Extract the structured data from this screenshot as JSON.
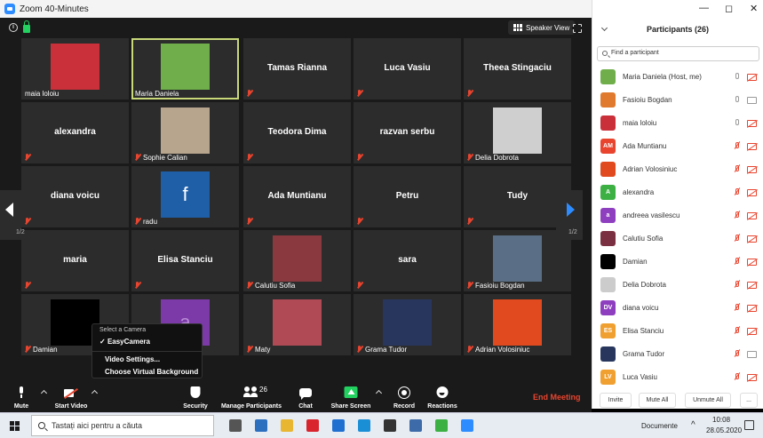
{
  "window": {
    "title": "Zoom 40-Minutes",
    "controls": [
      "—",
      "◻",
      "✕"
    ]
  },
  "meeting": {
    "speaker_view_label": "Speaker View",
    "page_indicator": "1/2",
    "tiles": [
      {
        "name": "maia loloiu",
        "type": "image",
        "color": "#c9303a"
      },
      {
        "name": "Maria Daniela",
        "type": "image",
        "active": true,
        "color": "#6fae4a"
      },
      {
        "name": "Tamas Rianna",
        "type": "name"
      },
      {
        "name": "Luca Vasiu",
        "type": "name"
      },
      {
        "name": "Theea Stingaciu",
        "type": "name"
      },
      {
        "name": "alexandra",
        "type": "name"
      },
      {
        "name": "Sophie Calian",
        "type": "image",
        "color": "#b8a58e"
      },
      {
        "name": "Teodora Dima",
        "type": "name"
      },
      {
        "name": "razvan serbu",
        "type": "name"
      },
      {
        "name": "Delia Dobrota",
        "type": "image",
        "color": "#cfcfcf"
      },
      {
        "name": "diana voicu",
        "type": "name"
      },
      {
        "name": "radu",
        "type": "facebook",
        "color": "#1e5fa8",
        "glyph": "f"
      },
      {
        "name": "Ada Muntianu",
        "type": "name"
      },
      {
        "name": "Petru",
        "type": "name"
      },
      {
        "name": "Tudy",
        "type": "name"
      },
      {
        "name": "maria",
        "type": "name"
      },
      {
        "name": "Elisa Stanciu",
        "type": "name"
      },
      {
        "name": "Calutiu Sofia",
        "type": "image",
        "color": "#8a3a3e"
      },
      {
        "name": "sara",
        "type": "name"
      },
      {
        "name": "Fasioiu Bogdan",
        "type": "image",
        "color": "#5a6f86"
      },
      {
        "name": "Damian",
        "type": "image",
        "color": "#000000"
      },
      {
        "name": "",
        "type": "image",
        "color": "#7b3aa8",
        "glyph": "a"
      },
      {
        "name": "Maty",
        "type": "image",
        "color": "#b04b56"
      },
      {
        "name": "Grama Tudor",
        "type": "image",
        "color": "#28365e"
      },
      {
        "name": "Adrian Volosiniuc",
        "type": "image",
        "color": "#e04a1e"
      }
    ]
  },
  "camera_menu": {
    "header": "Select a Camera",
    "selected": "EasyCamera",
    "options": [
      "Video Settings...",
      "Choose Virtual Background"
    ]
  },
  "toolbar": {
    "mute": "Mute",
    "start_video": "Start Video",
    "security": "Security",
    "manage_participants": "Manage Participants",
    "participant_count": "26",
    "chat": "Chat",
    "share_screen": "Share Screen",
    "record": "Record",
    "reactions": "Reactions",
    "end_meeting": "End Meeting"
  },
  "participants_panel": {
    "title": "Participants (26)",
    "search_placeholder": "Find a participant",
    "list": [
      {
        "name": "Maria Daniela (Host, me)",
        "avatar_color": "#6fae4a",
        "avatar_text": "",
        "mic_off": false,
        "cam_off": true
      },
      {
        "name": "Fasioiu Bogdan",
        "avatar_color": "#e07a2e",
        "avatar_text": "",
        "mic_off": false,
        "cam_off": false
      },
      {
        "name": "maia loloiu",
        "avatar_color": "#c9303a",
        "avatar_text": "",
        "mic_off": false,
        "cam_off": true
      },
      {
        "name": "Ada Muntianu",
        "avatar_color": "#e8442e",
        "avatar_text": "AM",
        "mic_off": true,
        "cam_off": true
      },
      {
        "name": "Adrian Volosiniuc",
        "avatar_color": "#e04a1e",
        "avatar_text": "",
        "mic_off": true,
        "cam_off": true
      },
      {
        "name": "alexandra",
        "avatar_color": "#3cb043",
        "avatar_text": "A",
        "mic_off": true,
        "cam_off": true
      },
      {
        "name": "andreea vasilescu",
        "avatar_color": "#8e3fbf",
        "avatar_text": "a",
        "mic_off": true,
        "cam_off": true
      },
      {
        "name": "Calutiu Sofia",
        "avatar_color": "#7a3040",
        "avatar_text": "",
        "mic_off": true,
        "cam_off": true
      },
      {
        "name": "Damian",
        "avatar_color": "#000000",
        "avatar_text": "",
        "mic_off": true,
        "cam_off": true
      },
      {
        "name": "Delia Dobrota",
        "avatar_color": "#cccccc",
        "avatar_text": "",
        "mic_off": true,
        "cam_off": true
      },
      {
        "name": "diana voicu",
        "avatar_color": "#8e3fbf",
        "avatar_text": "DV",
        "mic_off": true,
        "cam_off": true
      },
      {
        "name": "Elisa Stanciu",
        "avatar_color": "#f0a030",
        "avatar_text": "ES",
        "mic_off": true,
        "cam_off": true
      },
      {
        "name": "Grama Tudor",
        "avatar_color": "#28365e",
        "avatar_text": "",
        "mic_off": true,
        "cam_off": false
      },
      {
        "name": "Luca Vasiu",
        "avatar_color": "#f0a030",
        "avatar_text": "LV",
        "mic_off": true,
        "cam_off": true
      }
    ],
    "buttons": [
      "Invite",
      "Mute All",
      "Unmute All",
      "..."
    ]
  },
  "taskbar": {
    "search_placeholder": "Tastați aici pentru a căuta",
    "documents_label": "Documente",
    "time": "10:08",
    "date": "28.05.2020",
    "apps": [
      {
        "name": "task-view-icon",
        "color": "#555555"
      },
      {
        "name": "mail-icon",
        "color": "#2d6fbf"
      },
      {
        "name": "file-explorer-icon",
        "color": "#e8b631"
      },
      {
        "name": "opera-icon",
        "color": "#d9232d"
      },
      {
        "name": "office-icon",
        "color": "#1f6fd1"
      },
      {
        "name": "edge-icon",
        "color": "#1b8fd6"
      },
      {
        "name": "store-icon",
        "color": "#333333"
      },
      {
        "name": "photos-icon",
        "color": "#3d6aa8"
      },
      {
        "name": "app-icon",
        "color": "#3cb043"
      },
      {
        "name": "zoom-icon",
        "color": "#2d8cff"
      }
    ]
  }
}
